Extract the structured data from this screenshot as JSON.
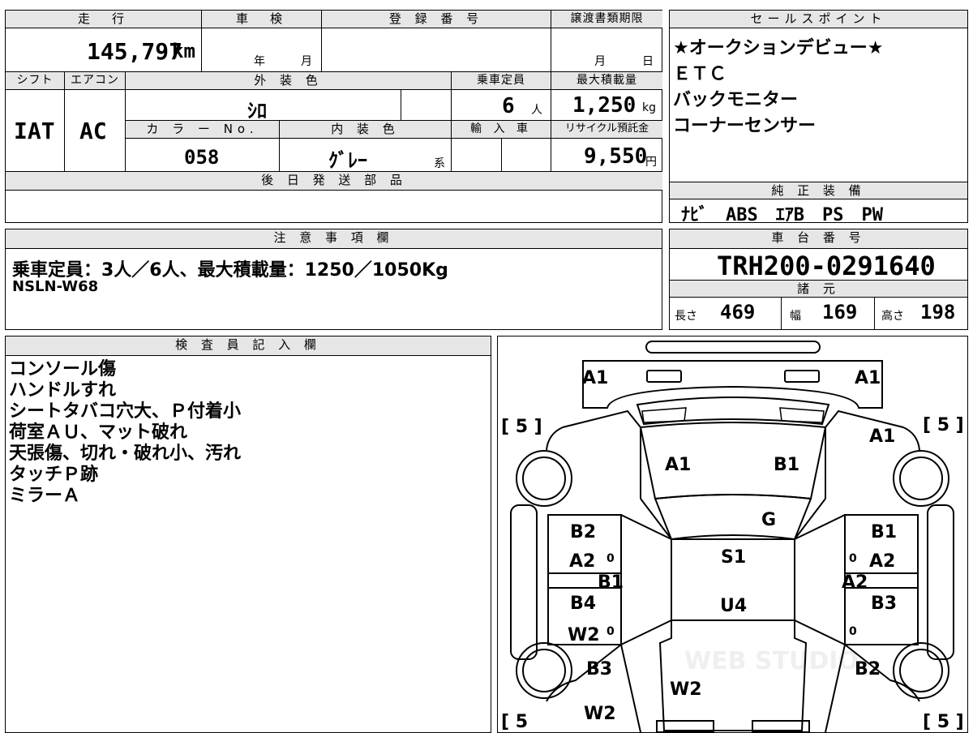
{
  "spec": {
    "mileage_label": "走　行",
    "mileage_value": "145,797",
    "mileage_unit": "km",
    "shaken_label": "車　検",
    "shaken_year_unit": "年",
    "shaken_month_unit": "月",
    "registration_label": "登 録 番 号",
    "transfer_deadline_label": "譲渡書類期限",
    "transfer_month_unit": "月",
    "transfer_day_unit": "日",
    "shift_label": "シフト",
    "aircon_label": "エアコン",
    "exterior_color_label": "外 装 色",
    "capacity_label": "乗車定員",
    "max_load_label": "最大積載量",
    "shift_value": "IAT",
    "aircon_value": "AC",
    "exterior_color_value": "ｼﾛ",
    "capacity_value": "6",
    "capacity_unit": "人",
    "max_load_value": "1,250",
    "max_load_unit": "kg",
    "color_no_label": "カ ラ ー No.",
    "interior_color_label": "内 装 色",
    "import_label": "輸 入 車",
    "recycle_label": "リサイクル預託金",
    "color_no_value": "058",
    "interior_color_value": "ｸﾞﾚｰ",
    "interior_color_suffix": "系",
    "recycle_value": "9,550",
    "recycle_unit": "円",
    "later_parts_label": "後 日 発 送 部 品"
  },
  "sales_points": {
    "header": "セールスポイント",
    "items": [
      "★オークションデビュー★",
      "ＥＴＣ",
      "バックモニター",
      "コーナーセンサー"
    ]
  },
  "equipment": {
    "header": "純 正 装 備",
    "value": "ﾅﾋﾞ　ABS　ｴｱB　PS　PW"
  },
  "notes": {
    "header": "注 意 事 項 欄",
    "line1": "乗車定員：3人／6人、最大積載量：1250／1050Kg",
    "line2": "NSLN-W68"
  },
  "chassis": {
    "header": "車 台 番 号",
    "value": "TRH200-0291640",
    "specs_header": "諸 元",
    "length_label": "長さ",
    "length_value": "469",
    "width_label": "幅",
    "width_value": "169",
    "height_label": "高さ",
    "height_value": "198"
  },
  "inspector": {
    "header": "検 査 員 記 入 欄",
    "lines": [
      "コンソール傷",
      "ハンドルすれ",
      "シートタバコ穴大、Ｐ付着小",
      "荷室ＡＵ、マット破れ",
      "天張傷、切れ・破れ小、汚れ",
      "タッチＰ跡",
      "ミラーＡ"
    ]
  },
  "diagram": {
    "tire_left_top": "[ 5 ]",
    "tire_right_top": "[ 5 ]",
    "tire_left_bottom": "[ 5",
    "tire_right_bottom": "[ 5 ]",
    "marks": [
      "A1",
      "A1",
      "A1",
      "A1",
      "B1",
      "G",
      "B2",
      "B1",
      "A2",
      "A2",
      "B1",
      "A2",
      "S1",
      "B4",
      "B3",
      "U4",
      "W2",
      "B3",
      "B2",
      "W2",
      "W2"
    ],
    "watermark": "WEB STUDIO"
  }
}
